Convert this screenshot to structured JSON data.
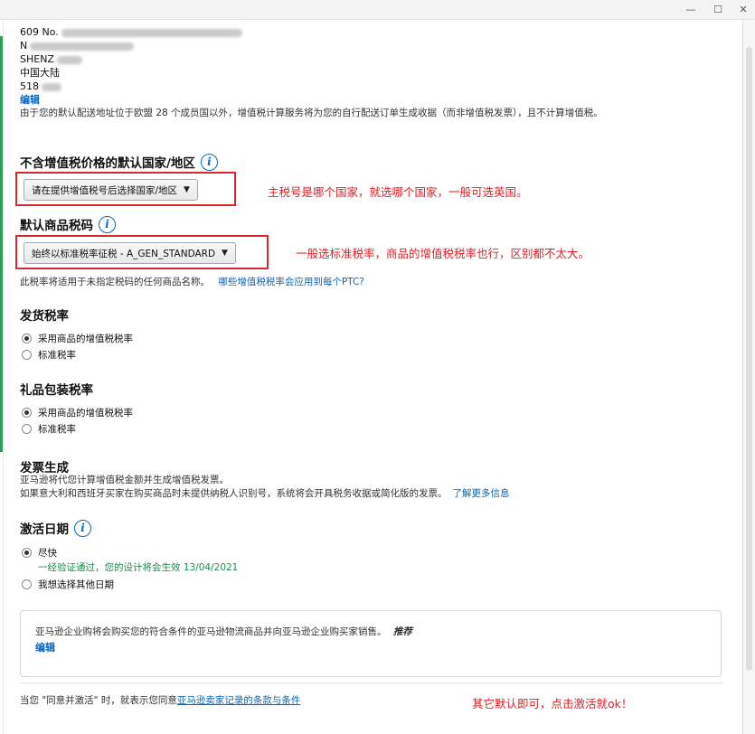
{
  "window": {
    "min_icon": "minimize-icon",
    "max_icon": "maximize-icon",
    "close_icon": "close-icon",
    "min_glyph": "—",
    "max_glyph": "☐",
    "close_glyph": "✕"
  },
  "address": {
    "line1": "609 No.",
    "line2": "N",
    "line3": "SHENZ",
    "line4": "中国大陆",
    "line5": "518",
    "edit": "编辑"
  },
  "vat_notice": "由于您的默认配送地址位于欧盟 28 个成员国以外，增值税计算服务将为您的自行配送订单生成收据（而非增值税发票），且不计算增值税。",
  "default_country": {
    "title": "不含增值税价格的默认国家/地区",
    "select_label": "请在提供增值税号后选择国家/地区",
    "annotation": "主税号是哪个国家，就选哪个国家，一般可选英国。"
  },
  "default_ptc": {
    "title": "默认商品税码",
    "select_label": "始终以标准税率征税 - A_GEN_STANDARD",
    "annotation": "一般选标准税率，商品的增值税税率也行，区别都不太大。",
    "note": "此税率将适用于未指定税码的任何商品名称。",
    "link": "哪些增值税税率会应用到每个PTC?"
  },
  "shipping_rate": {
    "title": "发货税率",
    "options": [
      "采用商品的增值税税率",
      "标准税率"
    ],
    "selected": 0
  },
  "gift_rate": {
    "title": "礼品包装税率",
    "options": [
      "采用商品的增值税税率",
      "标准税率"
    ],
    "selected": 0
  },
  "invoice": {
    "title": "发票生成",
    "line1": "亚马逊将代您计算增值税金额并生成增值税发票。",
    "line2": "如果意大利和西班牙买家在购买商品时未提供纳税人识别号，系统将会开具税务收据或简化版的发票。",
    "link": "了解更多信息"
  },
  "activation": {
    "title": "激活日期",
    "option1": "尽快",
    "option1_note": "一经验证通过，您的设计将会生效 13/04/2021",
    "option2": "我想选择其他日期"
  },
  "business": {
    "text": "亚马逊企业购将会购买您的符合条件的亚马逊物流商品并向亚马逊企业购买家销售。",
    "recommended": "推荐",
    "edit": "编辑"
  },
  "footer": {
    "prefix": "当您 \"同意并激活\" 时，就表示您同意",
    "link": "亚马逊卖家记录的条款与条件",
    "annotation": "其它默认即可，点击激活就ok！"
  }
}
